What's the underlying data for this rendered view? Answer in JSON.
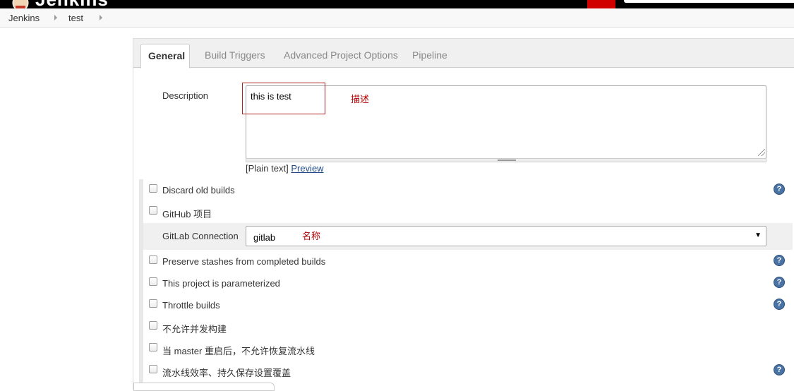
{
  "header": {
    "logo_text": "Jenkins"
  },
  "breadcrumb": {
    "items": [
      "Jenkins",
      "test"
    ]
  },
  "tabs": [
    {
      "label": "General",
      "active": true
    },
    {
      "label": "Build Triggers"
    },
    {
      "label": "Advanced Project Options"
    },
    {
      "label": "Pipeline"
    }
  ],
  "description": {
    "label": "Description",
    "value": "this is test",
    "annotation": "描述",
    "format_prefix": "[Plain text]",
    "preview_link": "Preview"
  },
  "options": [
    {
      "label": "Discard old builds",
      "help": true
    },
    {
      "label": "GitHub 项目",
      "help": false
    },
    {
      "label": "Preserve stashes from completed builds",
      "help": true
    },
    {
      "label": "This project is parameterized",
      "help": true
    },
    {
      "label": "Throttle builds",
      "help": true
    },
    {
      "label": "不允许并发构建",
      "help": false
    },
    {
      "label": "当 master 重启后，不允许恢复流水线",
      "help": false
    },
    {
      "label": "流水线效率、持久保存设置覆盖",
      "help": true
    }
  ],
  "gitlab": {
    "label": "GitLab Connection",
    "selected": "gitlab",
    "annotation": "名称"
  },
  "help_glyph": "?",
  "caret_glyph": "▼",
  "colors": {
    "topbar": "#000000",
    "accent_red": "#d10000",
    "annotation_red": "#b00000",
    "link": "#204a87",
    "help": "#4a73a5"
  }
}
